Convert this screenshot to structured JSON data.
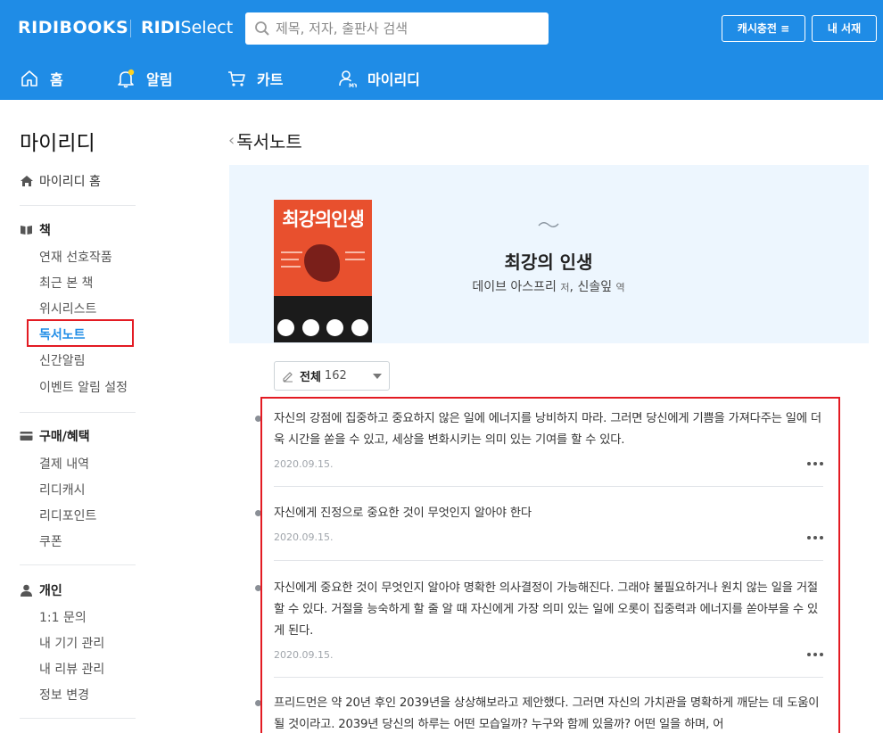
{
  "header": {
    "logo": "RIDIBOOKS",
    "select_logo_bold": "RIDI",
    "select_logo_light": "Select",
    "search_placeholder": "제목, 저자, 출판사 검색",
    "cash_button": "캐시충전",
    "library_button": "내 서재",
    "accent_color": "#1f8ce6"
  },
  "nav": {
    "home": "홈",
    "alerts": "알림",
    "cart": "카트",
    "myridi": "마이리디"
  },
  "sidebar": {
    "title": "마이리디",
    "home_link": "마이리디 홈",
    "books": {
      "label": "책",
      "items": [
        "연재 선호작품",
        "최근 본 책",
        "위시리스트",
        "독서노트",
        "신간알림",
        "이벤트 알림 설정"
      ]
    },
    "purchase": {
      "label": "구매/혜택",
      "items": [
        "결제 내역",
        "리디캐시",
        "리디포인트",
        "쿠폰"
      ]
    },
    "personal": {
      "label": "개인",
      "items": [
        "1:1 문의",
        "내 기기 관리",
        "내 리뷰 관리",
        "정보 변경"
      ]
    }
  },
  "main": {
    "page_title": "독서노트",
    "book": {
      "cover_title": "최강의인생",
      "title": "최강의 인생",
      "author": "데이브 아스프리",
      "author_role": "저",
      "translator": "신솔잎",
      "translator_role": "역"
    },
    "filter": {
      "label": "전체",
      "count": "162"
    },
    "notes": [
      {
        "text": "자신의 강점에 집중하고 중요하지 않은 일에 에너지를 낭비하지 마라. 그러면 당신에게 기쁨을 가져다주는 일에 더욱 시간을 쏟을 수 있고, 세상을 변화시키는 의미 있는 기여를 할 수 있다.",
        "date": "2020.09.15."
      },
      {
        "text": "자신에게 진정으로 중요한 것이 무엇인지 알아야 한다",
        "date": "2020.09.15."
      },
      {
        "text": "자신에게 중요한 것이 무엇인지 알아야 명확한 의사결정이 가능해진다. 그래야 불필요하거나 원치 않는 일을 거절할 수 있다. 거절을 능숙하게 할 줄 알 때 자신에게 가장 의미 있는 일에 오롯이 집중력과 에너지를 쏟아부을 수 있게 된다.",
        "date": "2020.09.15."
      },
      {
        "text": "프리드먼은 약 20년 후인 2039년을 상상해보라고 제안했다. 그러면 자신의 가치관을 명확하게 깨닫는 데 도움이 될 것이라고. 2039년 당신의 하루는 어떤 모습일까? 누구와 함께 있을까? 어떤 일을 하며, 어",
        "date": ""
      }
    ]
  }
}
